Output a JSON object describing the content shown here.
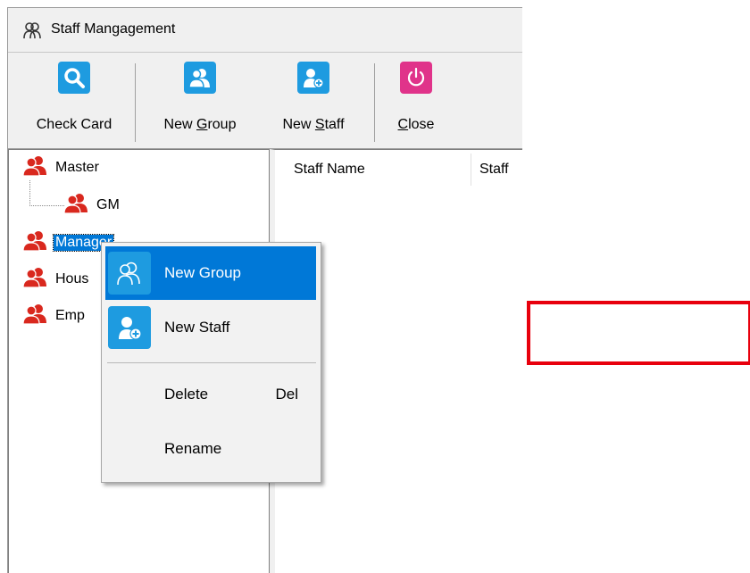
{
  "window": {
    "title": "Staff Mangagement"
  },
  "toolbar": {
    "check_card": "Check Card",
    "new_group_pre": "New ",
    "new_group_key": "G",
    "new_group_post": "roup",
    "new_staff_pre": "New ",
    "new_staff_key": "S",
    "new_staff_post": "taff",
    "close_key": "C",
    "close_post": "lose"
  },
  "tree": {
    "items": [
      {
        "label": "Master",
        "icon": "group-icon"
      },
      {
        "label": "GM",
        "icon": "group-icon"
      },
      {
        "label": "Manager",
        "icon": "group-icon",
        "selected": true
      },
      {
        "label": "Hous",
        "icon": "group-icon"
      },
      {
        "label": "Emp",
        "icon": "group-icon"
      }
    ]
  },
  "list": {
    "columns": [
      "Staff Name",
      "Staff"
    ]
  },
  "context_menu": {
    "items": [
      {
        "label": "New Group",
        "icon": "new-group-icon",
        "highlighted": true
      },
      {
        "label": "New Staff",
        "icon": "new-staff-icon"
      },
      {
        "label": "Delete",
        "shortcut": "Del"
      },
      {
        "label": "Rename"
      }
    ]
  },
  "colors": {
    "accent_blue": "#1e9be0",
    "close_pink": "#e0338a",
    "group_red": "#d9281e",
    "selection": "#0078d7",
    "annotation_red": "#e8000d"
  }
}
